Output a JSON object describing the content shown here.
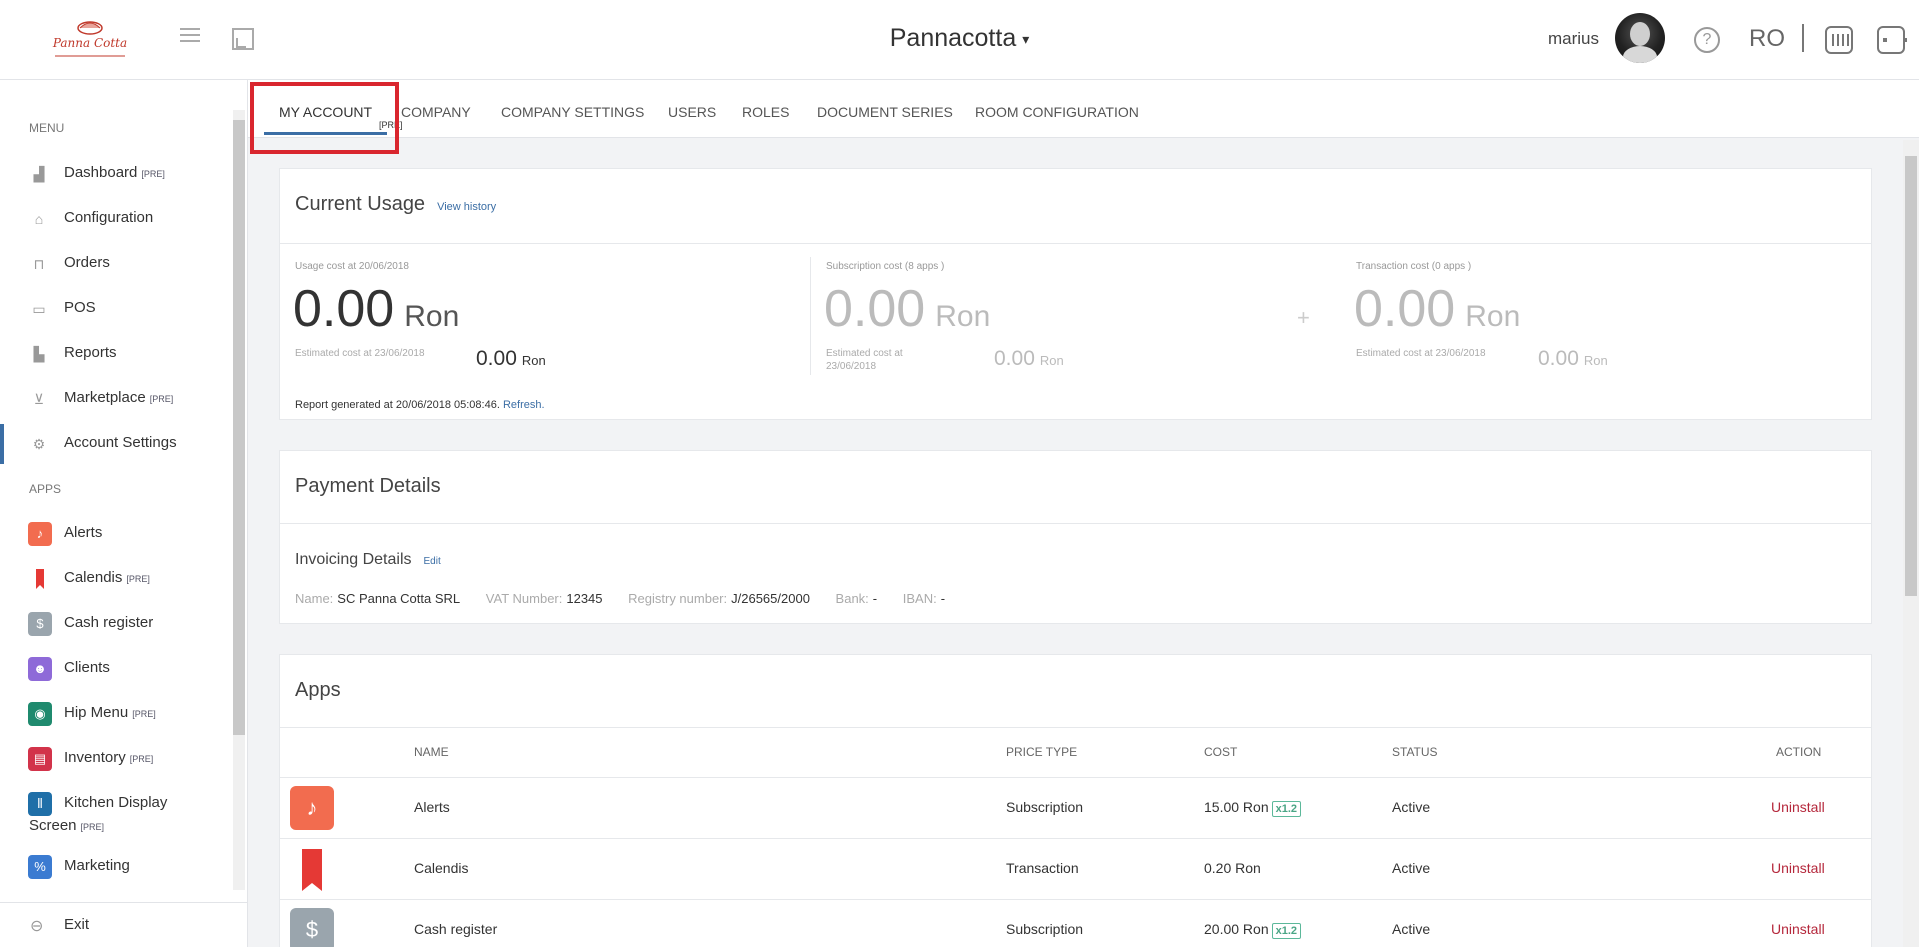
{
  "header": {
    "logo_text": "Panna Cotta",
    "title": "Pannacotta",
    "username": "marius",
    "language": "RO",
    "help_symbol": "?"
  },
  "sidebar": {
    "menu_heading": "MENU",
    "apps_heading": "APPS",
    "menu_items": [
      {
        "label": "Dashboard",
        "pre": "[PRE]",
        "icon": "chart-icon"
      },
      {
        "label": "Configuration",
        "pre": "",
        "icon": "tag-icon"
      },
      {
        "label": "Orders",
        "pre": "",
        "icon": "orders-icon"
      },
      {
        "label": "POS",
        "pre": "",
        "icon": "pos-icon"
      },
      {
        "label": "Reports",
        "pre": "",
        "icon": "reports-icon"
      },
      {
        "label": "Marketplace",
        "pre": "[PRE]",
        "icon": "cart-icon"
      },
      {
        "label": "Account Settings",
        "pre": "",
        "icon": "gear-icon"
      }
    ],
    "app_items": [
      {
        "label": "Alerts",
        "pre": "",
        "color": "#f26c4f"
      },
      {
        "label": "Calendis",
        "pre": "[PRE]",
        "color": "#e53935"
      },
      {
        "label": "Cash register",
        "pre": "",
        "color": "#9aa5ad"
      },
      {
        "label": "Clients",
        "pre": "",
        "color": "#8e6ad8"
      },
      {
        "label": "Hip Menu",
        "pre": "[PRE]",
        "color": "#1f8a6e"
      },
      {
        "label": "Inventory",
        "pre": "[PRE]",
        "color": "#d2334a"
      },
      {
        "label": "Kitchen Display",
        "label2": "Screen",
        "pre": "[PRE]",
        "color": "#1f6fa8"
      },
      {
        "label": "Marketing",
        "pre": "",
        "color": "#3b7bd1"
      }
    ],
    "exit_label": "Exit"
  },
  "tabs": {
    "items": [
      "MY ACCOUNT",
      "COMPANY",
      "COMPANY SETTINGS",
      "USERS",
      "ROLES",
      "DOCUMENT SERIES",
      "ROOM CONFIGURATION"
    ],
    "my_account_pre": "[PRE]",
    "active": "MY ACCOUNT"
  },
  "usage": {
    "title": "Current Usage",
    "history_link": "View history",
    "total": {
      "label": "Usage cost at 20/06/2018",
      "value": "0.00",
      "unit": "Ron",
      "est_label": "Estimated cost at 23/06/2018",
      "est_value": "0.00",
      "est_unit": "Ron"
    },
    "subscription": {
      "label": "Subscription cost (8 apps )",
      "value": "0.00",
      "unit": "Ron",
      "est_label_1": "Estimated cost at",
      "est_label_2": "23/06/2018",
      "est_value": "0.00",
      "est_unit": "Ron"
    },
    "plus_sign": "+",
    "transaction": {
      "label": "Transaction cost (0 apps )",
      "value": "0.00",
      "unit": "Ron",
      "est_label": "Estimated cost at 23/06/2018",
      "est_value": "0.00",
      "est_unit": "Ron"
    },
    "report_text": "Report generated at 20/06/2018 05:08:46.",
    "refresh_link": "Refresh."
  },
  "payment": {
    "title": "Payment Details",
    "invoicing_title": "Invoicing Details",
    "edit_link": "Edit",
    "name_label": "Name:",
    "name_value": "SC Panna Cotta SRL",
    "vat_label": "VAT Number:",
    "vat_value": "12345",
    "registry_label": "Registry number:",
    "registry_value": "J/26565/2000",
    "bank_label": "Bank:",
    "bank_value": "-",
    "iban_label": "IBAN:",
    "iban_value": "-"
  },
  "apps": {
    "title": "Apps",
    "columns": [
      "NAME",
      "PRICE TYPE",
      "COST",
      "STATUS",
      "ACTION"
    ],
    "rows": [
      {
        "name": "Alerts",
        "price_type": "Subscription",
        "cost": "15.00 Ron",
        "badge": "x1.2",
        "status": "Active",
        "action": "Uninstall",
        "color": "#f26c4f"
      },
      {
        "name": "Calendis",
        "price_type": "Transaction",
        "cost": "0.20 Ron",
        "badge": "",
        "status": "Active",
        "action": "Uninstall",
        "color": "#e53935"
      },
      {
        "name": "Cash register",
        "price_type": "Subscription",
        "cost": "20.00 Ron",
        "badge": "x1.2",
        "status": "Active",
        "action": "Uninstall",
        "color": "#9aa5ad"
      }
    ]
  }
}
